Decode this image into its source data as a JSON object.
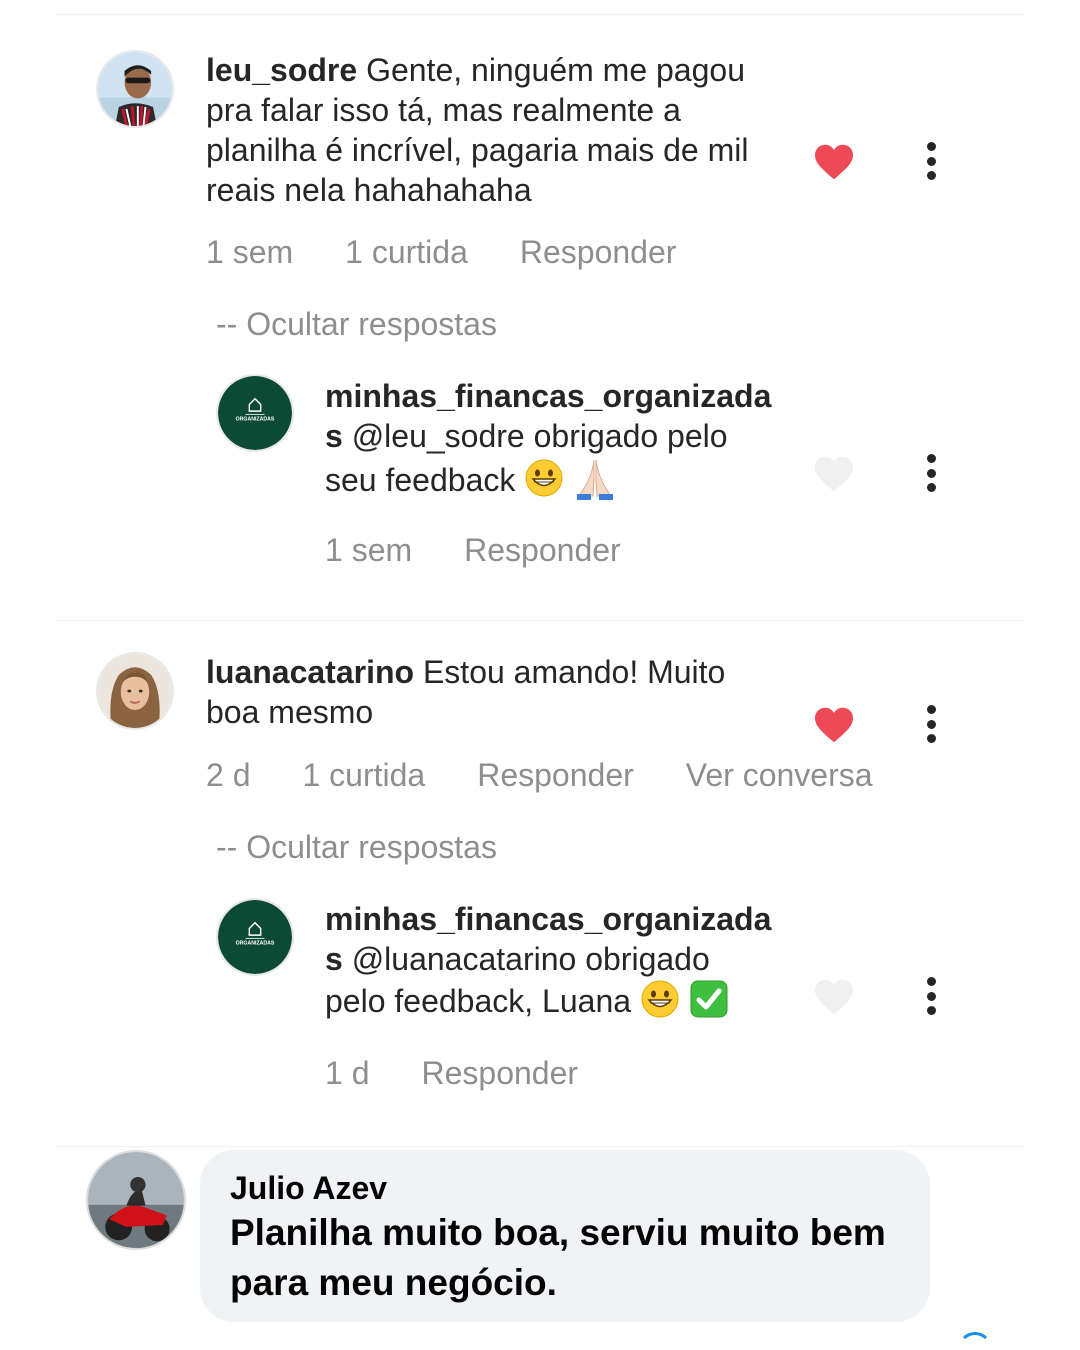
{
  "comments": [
    {
      "user": "leu_sodre",
      "text": "Gente, ninguém me pagou pra falar isso tá, mas realmente a planilha é incrível, pagaria mais de mil reais nela hahahahaha",
      "time": "1 sem",
      "likes": "1 curtida",
      "reply_label": "Responder",
      "liked": true,
      "hide_replies": "-- Ocultar respostas",
      "reply": {
        "user": "minhas_financas_organizadas",
        "text": "@leu_sodre obrigado pelo seu feedback",
        "emojis": [
          "grinning-face",
          "folded-hands"
        ],
        "time": "1 sem",
        "reply_label": "Responder",
        "liked": false
      }
    },
    {
      "user": "luanacatarino",
      "text": "Estou amando! Muito boa mesmo",
      "time": "2 d",
      "likes": "1 curtida",
      "reply_label": "Responder",
      "view_conversation": "Ver conversa",
      "liked": true,
      "hide_replies": "-- Ocultar respostas",
      "reply": {
        "user": "minhas_financas_organizadas",
        "text": "@luanacatarino obrigado pelo feedback, Luana",
        "emojis": [
          "grinning-face",
          "check-mark-button"
        ],
        "time": "1 d",
        "reply_label": "Responder",
        "liked": false
      }
    }
  ],
  "logo_text": "ORGANIZADAS",
  "facebook_comment": {
    "name": "Julio Azev",
    "text": "Planilha muito boa, serviu muito bem para meu negócio."
  },
  "colors": {
    "heart_liked": "#ed4956",
    "heart_unliked": "#f0f0f0",
    "muted_text": "#8e8e8e",
    "logo_green": "#0d4a35",
    "bubble_bg": "#f0f2f5"
  }
}
